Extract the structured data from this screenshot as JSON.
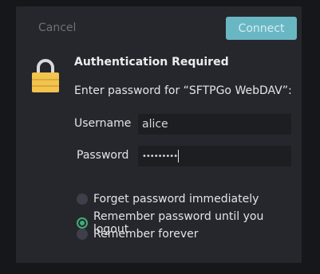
{
  "dialog": {
    "cancel_label": "Cancel",
    "connect_label": "Connect",
    "title": "Authentication Required",
    "prompt": "Enter password for “SFTPGo WebDAV”:",
    "username_label": "Username",
    "username_value": "alice",
    "password_label": "Password",
    "password_value": "•••••••••",
    "options": [
      {
        "label": "Forget password immediately",
        "selected": false
      },
      {
        "label": "Remember password until you logout",
        "selected": true
      },
      {
        "label": "Remember forever",
        "selected": false
      }
    ],
    "icon": "lock-icon",
    "colors": {
      "accent": "#6ab7c4",
      "radio_selected": "#3fae7b",
      "lock_body": "#f2c44e"
    }
  }
}
